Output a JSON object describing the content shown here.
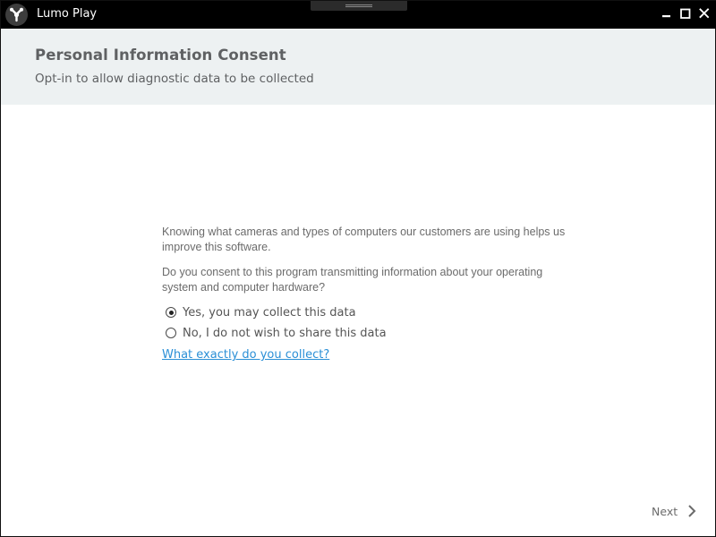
{
  "window": {
    "title": "Lumo Play",
    "logo_icon": "lumo-logo-icon",
    "controls": [
      "minimize-icon",
      "maximize-icon",
      "close-icon"
    ]
  },
  "header": {
    "title": "Personal Information Consent",
    "subtitle": "Opt-in to allow diagnostic data to be collected",
    "background": "#edf1f2"
  },
  "content": {
    "paragraph1": "Knowing what cameras and types of computers our customers are using helps us improve this software.",
    "paragraph2": "Do you consent to this program transmitting information about your operating system and computer hardware?",
    "options": [
      {
        "label": "Yes, you may collect this data",
        "selected": true
      },
      {
        "label": "No, I do not wish to share this data",
        "selected": false
      }
    ],
    "link_text": "What exactly do you collect?",
    "link_color": "#2a8fd6"
  },
  "footer": {
    "next_label": "Next",
    "next_icon": "chevron-right-icon"
  }
}
